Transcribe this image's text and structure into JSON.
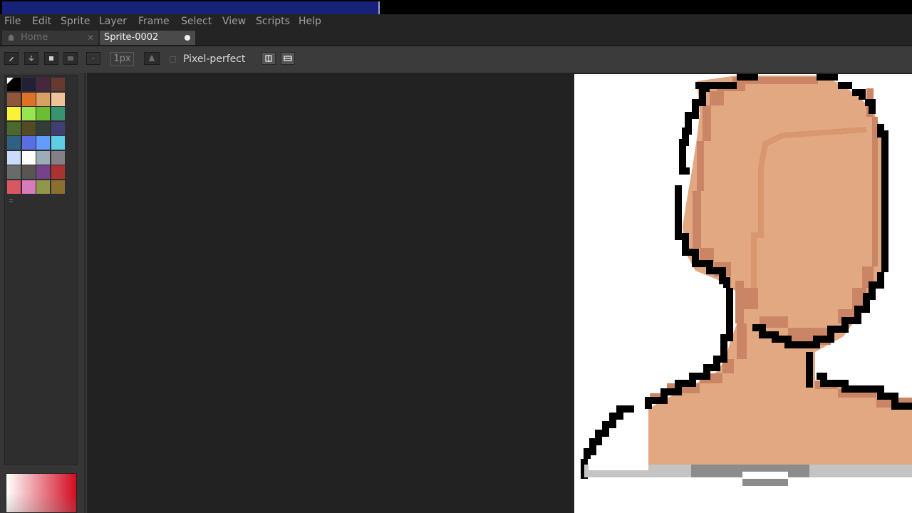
{
  "menubar": {
    "items": [
      {
        "key": "file",
        "label": "File"
      },
      {
        "key": "edit",
        "label": "Edit"
      },
      {
        "key": "sprite",
        "label": "Sprite"
      },
      {
        "key": "layer",
        "label": "Layer"
      },
      {
        "key": "frame",
        "label": "Frame"
      },
      {
        "key": "select",
        "label": "Select"
      },
      {
        "key": "view",
        "label": "View"
      },
      {
        "key": "scripts",
        "label": "Scripts"
      },
      {
        "key": "help",
        "label": "Help"
      }
    ]
  },
  "tabs": {
    "home": {
      "label": "Home",
      "close_glyph": "✕",
      "icon": "home-icon"
    },
    "active": {
      "label": "Sprite-0002",
      "modified_icon": "unsaved-dot-icon"
    }
  },
  "toolbar": {
    "brush_size": "1px",
    "pixel_perfect_label": "Pixel-perfect",
    "pixel_perfect_checked": false
  },
  "palette": {
    "colors": [
      "#000000",
      "#222034",
      "#45283c",
      "#663931",
      "#8f563b",
      "#df7126",
      "#d9a066",
      "#eec39a",
      "#fbf236",
      "#99e550",
      "#6abe30",
      "#37946e",
      "#4b692f",
      "#524b24",
      "#323c39",
      "#3f3f74",
      "#306082",
      "#5b6ee1",
      "#639bff",
      "#5fcde4",
      "#cbdbfc",
      "#ffffff",
      "#9badb7",
      "#847e87",
      "#696a6a",
      "#595652",
      "#76428a",
      "#ac3232",
      "#d95763",
      "#d77bba",
      "#8f974a",
      "#8a6f30"
    ]
  },
  "color_picker": {
    "hue_color": "#d40a20"
  },
  "canvas": {
    "colors": {
      "outline": "#000000",
      "skin": "#e2a882",
      "skin_shadow": "#c98565",
      "shirt_light": "#c4c4c4",
      "shirt_dark": "#8c8c8c",
      "background": "#ffffff"
    }
  }
}
